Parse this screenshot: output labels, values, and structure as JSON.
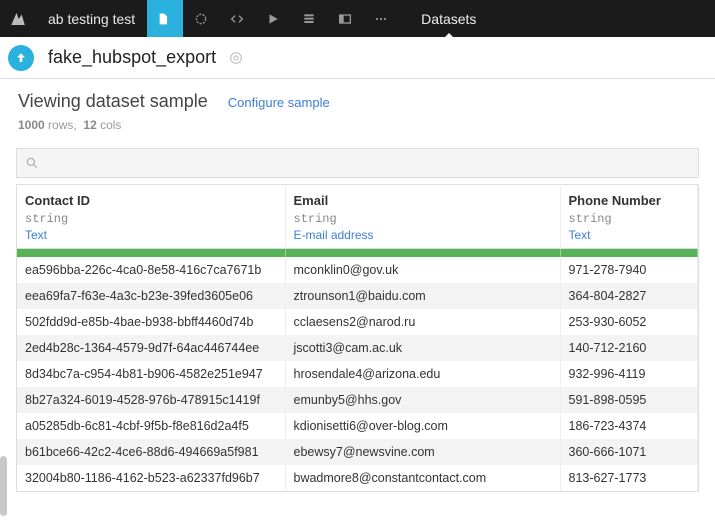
{
  "topbar": {
    "project_name": "ab testing test",
    "tab_label": "Datasets"
  },
  "dataset": {
    "name": "fake_hubspot_export"
  },
  "subheader": {
    "title": "Viewing dataset sample",
    "configure_link": "Configure sample",
    "rows_count": "1000",
    "rows_label": "rows,",
    "cols_count": "12",
    "cols_label": "cols"
  },
  "columns": [
    {
      "name": "Contact ID",
      "type": "string",
      "meaning": "Text"
    },
    {
      "name": "Email",
      "type": "string",
      "meaning": "E-mail address"
    },
    {
      "name": "Phone Number",
      "type": "string",
      "meaning": "Text"
    }
  ],
  "rows": [
    {
      "id": "ea596bba-226c-4ca0-8e58-416c7ca7671b",
      "email": "mconklin0@gov.uk",
      "phone": "971-278-7940"
    },
    {
      "id": "eea69fa7-f63e-4a3c-b23e-39fed3605e06",
      "email": "ztrounson1@baidu.com",
      "phone": "364-804-2827"
    },
    {
      "id": "502fdd9d-e85b-4bae-b938-bbff4460d74b",
      "email": "cclaesens2@narod.ru",
      "phone": "253-930-6052"
    },
    {
      "id": "2ed4b28c-1364-4579-9d7f-64ac446744ee",
      "email": "jscotti3@cam.ac.uk",
      "phone": "140-712-2160"
    },
    {
      "id": "8d34bc7a-c954-4b81-b906-4582e251e947",
      "email": "hrosendale4@arizona.edu",
      "phone": "932-996-4119"
    },
    {
      "id": "8b27a324-6019-4528-976b-478915c1419f",
      "email": "emunby5@hhs.gov",
      "phone": "591-898-0595"
    },
    {
      "id": "a05285db-6c81-4cbf-9f5b-f8e816d2a4f5",
      "email": "kdionisetti6@over-blog.com",
      "phone": "186-723-4374"
    },
    {
      "id": "b61bce66-42c2-4ce6-88d6-494669a5f981",
      "email": "ebewsy7@newsvine.com",
      "phone": "360-666-1071"
    },
    {
      "id": "32004b80-1186-4162-b523-a62337fd96b7",
      "email": "bwadmore8@constantcontact.com",
      "phone": "813-627-1773"
    }
  ]
}
